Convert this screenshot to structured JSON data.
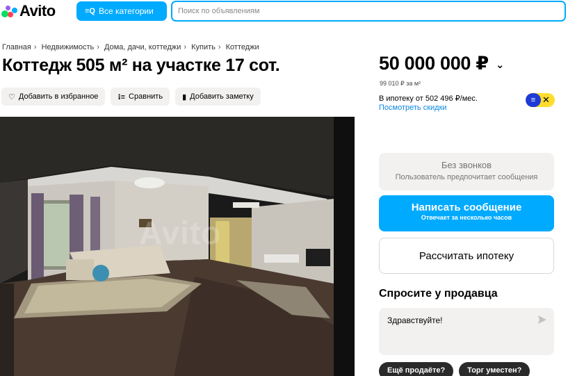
{
  "header": {
    "logo_text": "Avito",
    "logo_dot_colors": [
      "#04e061",
      "#ff4053",
      "#965eeb",
      "#0af"
    ],
    "categories_button": "Все категории",
    "search_placeholder": "Поиск по объявлениям",
    "accent_color": "#00aaff"
  },
  "breadcrumbs": [
    "Главная",
    "Недвижимость",
    "Дома, дачи, коттеджи",
    "Купить",
    "Коттеджи"
  ],
  "title": "Коттедж 505 м² на участке 17 сот.",
  "actions": {
    "favorite": "Добавить в избранное",
    "compare": "Сравнить",
    "note": "Добавить заметку"
  },
  "photo": {
    "watermark": "Avito",
    "icon": "listing-photo"
  },
  "pricing": {
    "price": "50 000 000 ₽",
    "per_meter": "99 010 ₽ за м²",
    "mortgage": "В ипотеку от 502 496 ₽/мес.",
    "discount_link": "Посмотреть скидки"
  },
  "contact": {
    "no_calls_title": "Без звонков",
    "no_calls_subtitle": "Пользователь предпочитает сообщения",
    "write_title": "Написать сообщение",
    "write_subtitle": "Отвечает за несколько часов",
    "mortgage_button": "Рассчитать ипотеку"
  },
  "ask": {
    "title": "Спросите у продавца",
    "message": "Здравствуйте!",
    "chips": [
      "Ещё продаёте?",
      "Торг уместен?"
    ]
  }
}
